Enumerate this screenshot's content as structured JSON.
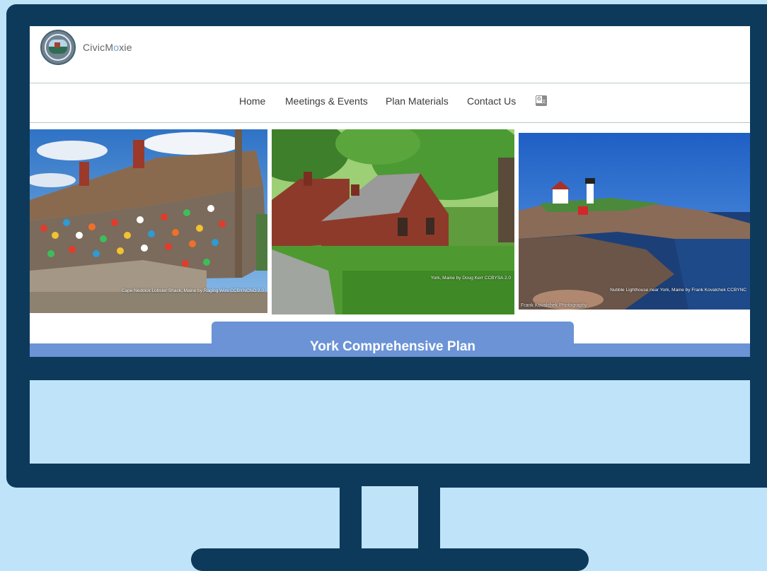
{
  "header": {
    "brand_prefix": "CivicM",
    "brand_o": "o",
    "brand_suffix": "xie"
  },
  "nav": {
    "items": [
      {
        "label": "Home"
      },
      {
        "label": "Meetings & Events"
      },
      {
        "label": "Plan Materials"
      },
      {
        "label": "Contact Us"
      }
    ]
  },
  "photos": [
    {
      "caption": "Cape Neddick Lobster Shack, Maine by Raging Wire CCBYNCND 2.0"
    },
    {
      "caption": "York, Maine by Doug Kerr CCBYSA 2.0"
    },
    {
      "caption": "Nubble Lighthouse near York, Maine by Frank Kovalchek CCBYNC",
      "watermark": "Frank Kovalchek Photography"
    }
  ],
  "hero": {
    "title": "York Comprehensive Plan"
  },
  "colors": {
    "monitor": "#0d3a5b",
    "background": "#bfe3f8",
    "accent": "#6b93d6",
    "brand_o": "#6aa3d7"
  },
  "icons": {
    "logo": "town-seal-icon",
    "translate": "google-translate-icon"
  }
}
